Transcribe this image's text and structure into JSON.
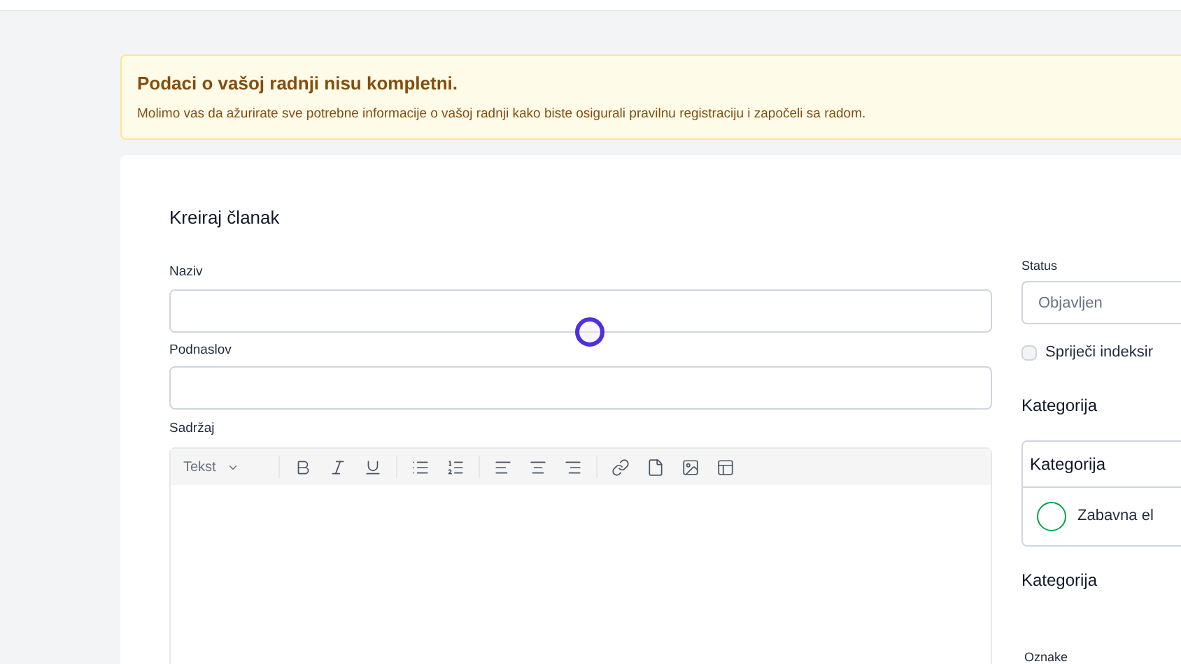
{
  "alert": {
    "title": "Podaci o vašoj radnji nisu kompletni.",
    "message": "Molimo vas da ažurirate sve potrebne informacije o vašoj radnji kako biste osigurali pravilnu registraciju i započeli sa radom."
  },
  "form": {
    "title": "Kreiraj članak",
    "fields": [
      {
        "label": "Naziv"
      },
      {
        "label": "Podnaslov"
      }
    ],
    "content_label": "Sadržaj",
    "toolbar": {
      "format": "Tekst",
      "tools": [
        {
          "kind": "bold"
        },
        {
          "kind": "italic"
        },
        {
          "kind": "underline"
        },
        {
          "kind": "bullets"
        },
        {
          "kind": "numbers"
        },
        {
          "kind": "left"
        },
        {
          "kind": "center"
        },
        {
          "kind": "right"
        },
        {
          "kind": "link"
        },
        {
          "kind": "file"
        },
        {
          "kind": "image"
        },
        {
          "kind": "layout"
        }
      ]
    }
  },
  "sidebar": {
    "status_label": "Status",
    "status_value": "Objavljen",
    "noindex": {
      "label": "Spriječi indeksir",
      "checked": false
    },
    "category_heading": "Kategorija",
    "category_box": {
      "title": "Kategorija",
      "options": [
        {
          "label": "Zabavna el",
          "selected": false
        }
      ]
    },
    "category_heading_2": "Kategorija",
    "tags_label": "Oznake"
  }
}
